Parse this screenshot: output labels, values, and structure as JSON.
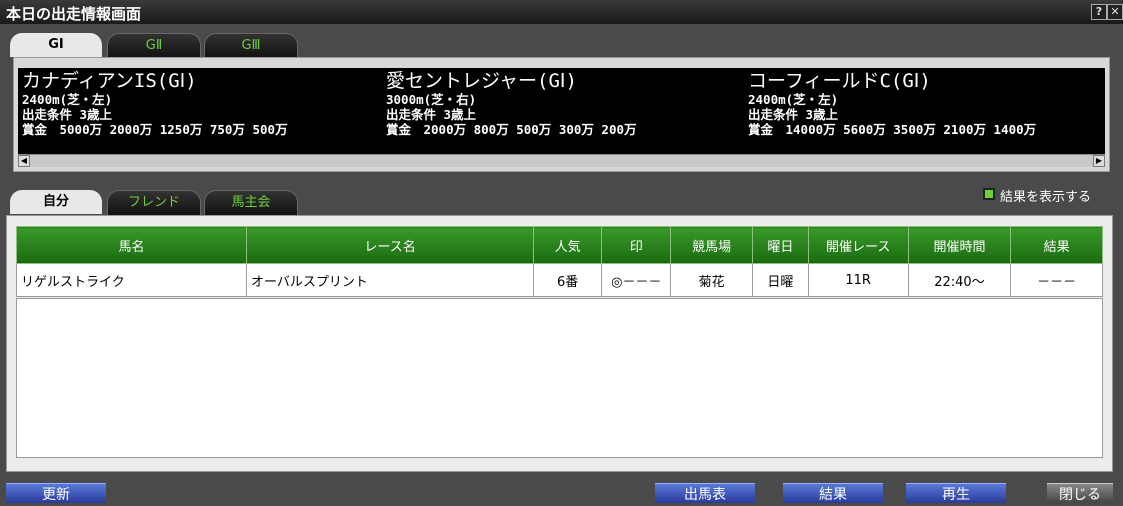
{
  "window": {
    "title": "本日の出走情報画面",
    "help_label": "?",
    "close_label": "✕"
  },
  "grade_tabs": [
    "GⅠ",
    "GⅡ",
    "GⅢ"
  ],
  "races": [
    {
      "name": "カナディアンIS(GⅠ)",
      "distance": "2400m(芝・左)",
      "condition": "出走条件 3歳上",
      "prize": "賞金　5000万 2000万 1250万 750万 500万"
    },
    {
      "name": "愛セントレジャー(GⅠ)",
      "distance": "3000m(芝・右)",
      "condition": "出走条件 3歳上",
      "prize": "賞金　2000万 800万 500万 300万 200万"
    },
    {
      "name": "コーフィールドC(GⅠ)",
      "distance": "2400m(芝・左)",
      "condition": "出走条件 3歳上",
      "prize": "賞金　14000万 5600万 3500万 2100万 1400万"
    }
  ],
  "owner_tabs": [
    "自分",
    "フレンド",
    "馬主会"
  ],
  "show_results_label": "結果を表示する",
  "table": {
    "headers": [
      "馬名",
      "レース名",
      "人気",
      "印",
      "競馬場",
      "曜日",
      "開催レース",
      "開催時間",
      "結果"
    ],
    "rows": [
      [
        "リゲルストライク",
        "オーバルスプリント",
        "6番",
        "◎－－－",
        "菊花",
        "日曜",
        "11R",
        "22:40～",
        "－－－"
      ]
    ]
  },
  "buttons": {
    "update": "更新",
    "entries": "出馬表",
    "result": "結果",
    "replay": "再生",
    "close": "閉じる"
  },
  "colors": {
    "accent_green": "#6fcf3a",
    "header_green": "#1a6a10",
    "button_blue": "#2a3a9a"
  }
}
